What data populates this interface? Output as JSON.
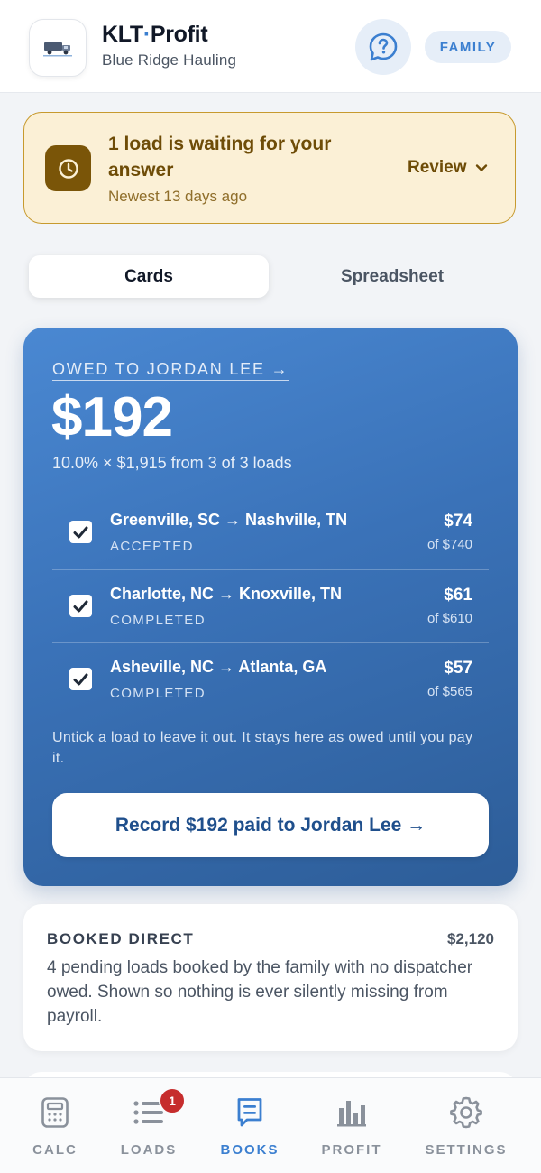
{
  "header": {
    "app_name_left": "KLT",
    "app_name_right": "Profit",
    "company": "Blue Ridge Hauling",
    "role_badge": "FAMILY",
    "help_icon": "question-bubble-icon",
    "logo_icon": "truck-logo-icon"
  },
  "alert": {
    "title": "1 load is waiting for your answer",
    "subtitle": "Newest 13 days ago",
    "action_label": "Review",
    "icon": "clock-icon",
    "colors": {
      "background": "#fbf0d6",
      "border": "#c79a2e",
      "text": "#6e4c07"
    }
  },
  "tabs": [
    {
      "label": "Cards",
      "active": true
    },
    {
      "label": "Spreadsheet",
      "active": false
    }
  ],
  "owed": {
    "link_label": "OWED TO JORDAN LEE →",
    "amount": "$192",
    "summary": "10.0% × $1,915 from 3 of 3 loads",
    "loads": [
      {
        "route": "Greenville, SC → Nashville, TN",
        "status": "ACCEPTED",
        "share": "$74",
        "gross": "of $740",
        "checked": true
      },
      {
        "route": "Charlotte, NC → Knoxville, TN",
        "status": "COMPLETED",
        "share": "$61",
        "gross": "of $610",
        "checked": true
      },
      {
        "route": "Asheville, NC → Atlanta, GA",
        "status": "COMPLETED",
        "share": "$57",
        "gross": "of $565",
        "checked": true
      }
    ],
    "note": "Untick a load to leave it out. It stays here as owed until you pay it.",
    "record_button": "Record $192 paid to Jordan Lee →",
    "colors": {
      "card_start": "#4a88d2",
      "card_end": "#2d5d98"
    }
  },
  "booked_direct": {
    "title": "BOOKED DIRECT",
    "amount": "$2,120",
    "description": "4 pending loads booked by the family with no dispatcher owed. Shown so nothing is ever silently missing from payroll."
  },
  "nav": {
    "items": [
      {
        "label": "CALC",
        "icon": "calculator-icon",
        "active": false
      },
      {
        "label": "LOADS",
        "icon": "list-icon",
        "active": false,
        "badge": "1"
      },
      {
        "label": "BOOKS",
        "icon": "book-icon",
        "active": true
      },
      {
        "label": "PROFIT",
        "icon": "bar-chart-icon",
        "active": false
      },
      {
        "label": "SETTINGS",
        "icon": "gear-icon",
        "active": false
      }
    ],
    "colors": {
      "active": "#3b7fd0",
      "inactive": "#8a919b",
      "badge": "#c62d2d"
    }
  }
}
